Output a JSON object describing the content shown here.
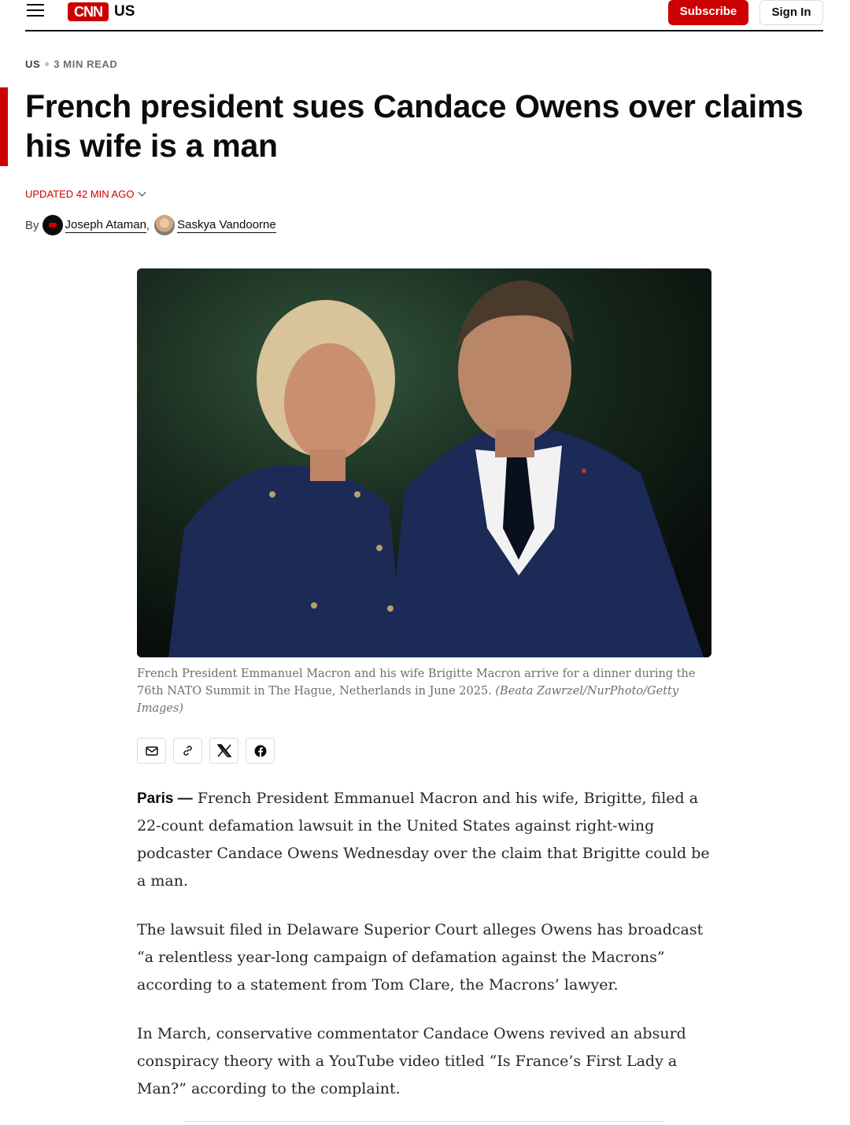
{
  "header": {
    "logo_text": "CNN",
    "edition": "US",
    "subscribe_label": "Subscribe",
    "signin_label": "Sign In",
    "menu_icon": "hamburger-menu-icon"
  },
  "article": {
    "section": "US",
    "read_time": "3 MIN READ",
    "headline": "French president sues Candace Owens over claims his wife is a man",
    "updated": "UPDATED 42 MIN AGO",
    "by_label": "By",
    "authors": [
      {
        "name": "Joseph Ataman",
        "separator": ","
      },
      {
        "name": "Saskya Vandoorne",
        "separator": ""
      }
    ],
    "image": {
      "caption": "French President Emmanuel Macron and his wife Brigitte Macron arrive for a dinner during the 76th NATO Summit in The Hague, Netherlands in June 2025.",
      "credit": "(Beata Zawrzel/NurPhoto/Getty Images)"
    },
    "share_icons": [
      "email-icon",
      "link-icon",
      "x-icon",
      "facebook-icon"
    ],
    "dateline": "Paris —",
    "paragraphs": [
      "French President Emmanuel Macron and his wife, Brigitte, filed a 22-count defamation lawsuit in the United States against right-wing podcaster Candace Owens Wednesday over the claim that Brigitte could be a man.",
      "The lawsuit filed in Delaware Superior Court alleges Owens has broadcast “a relentless year-long campaign of defamation against the Macrons” according to a statement from Tom Clare, the Macrons’ lawyer.",
      "In March, conservative commentator Candace Owens revived an absurd conspiracy theory with a YouTube video titled “Is France’s First Lady a Man?” according to the complaint."
    ]
  },
  "colors": {
    "brand_red": "#cc0000",
    "text": "#0c0c0c",
    "caption": "#6e6e6e"
  }
}
